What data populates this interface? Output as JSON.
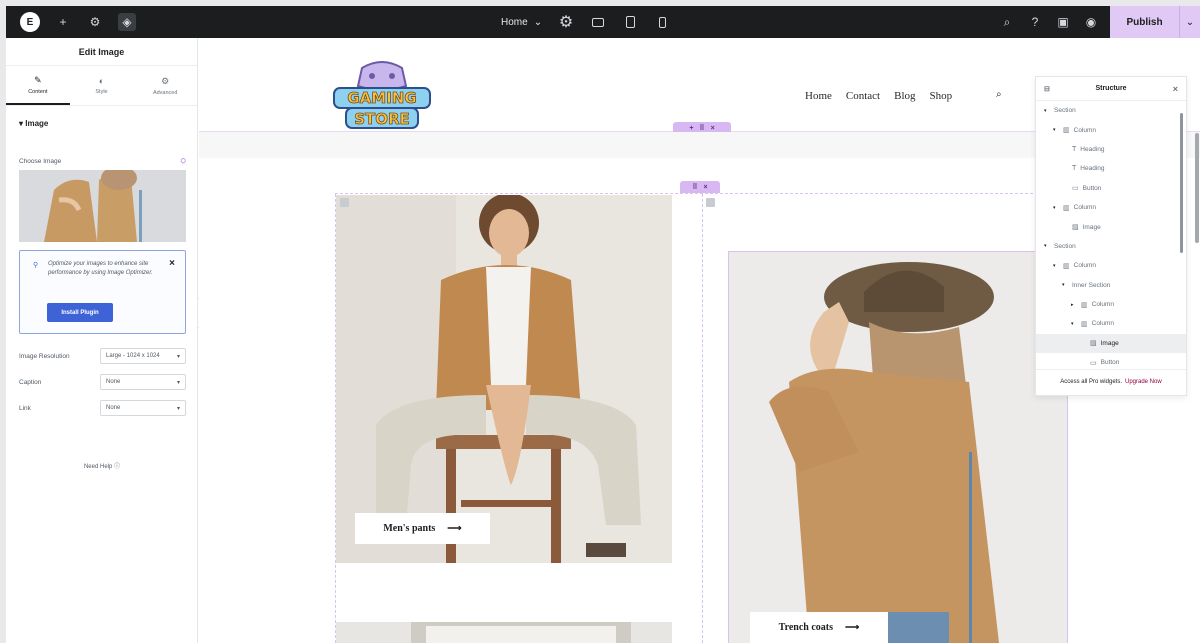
{
  "topbar": {
    "page_name": "Home",
    "publish_label": "Publish"
  },
  "panel": {
    "title": "Edit Image",
    "tabs": [
      {
        "label": "Content",
        "icon": "pencil-icon"
      },
      {
        "label": "Style",
        "icon": "contrast-icon"
      },
      {
        "label": "Advanced",
        "icon": "gear-icon"
      }
    ],
    "section_title": "Image",
    "choose_image_label": "Choose Image",
    "notice_text": "Optimize your images to enhance site performance by using Image Optimizer.",
    "install_label": "Install Plugin",
    "controls": [
      {
        "label": "Image Resolution",
        "value": "Large - 1024 x 1024"
      },
      {
        "label": "Caption",
        "value": "None"
      },
      {
        "label": "Link",
        "value": "None"
      }
    ],
    "need_help": "Need Help"
  },
  "site": {
    "logo_line1": "GAMING",
    "logo_line2": "STORE",
    "nav": [
      "Home",
      "Contact",
      "Blog",
      "Shop"
    ]
  },
  "cards": {
    "left_cta": "Men's pants",
    "right_cta": "Trench coats"
  },
  "structure": {
    "title": "Structure",
    "items": [
      {
        "label": "Section",
        "type": "section"
      },
      {
        "label": "Column",
        "type": "column"
      },
      {
        "label": "Heading",
        "type": "heading"
      },
      {
        "label": "Heading",
        "type": "heading"
      },
      {
        "label": "Button",
        "type": "button"
      },
      {
        "label": "Column",
        "type": "column"
      },
      {
        "label": "Image",
        "type": "image"
      },
      {
        "label": "Section",
        "type": "section"
      },
      {
        "label": "Column",
        "type": "column"
      },
      {
        "label": "Inner Section",
        "type": "inner-section"
      },
      {
        "label": "Column",
        "type": "column"
      },
      {
        "label": "Column",
        "type": "column"
      },
      {
        "label": "Image",
        "type": "image"
      },
      {
        "label": "Button",
        "type": "button"
      }
    ],
    "footer_text": "Access all Pro widgets.",
    "footer_link": "Upgrade Now"
  },
  "colors": {
    "accent": "#e0c9f5",
    "topbar": "#1c1d1f",
    "install_button": "#3d63d6",
    "upgrade_link": "#93003f"
  }
}
